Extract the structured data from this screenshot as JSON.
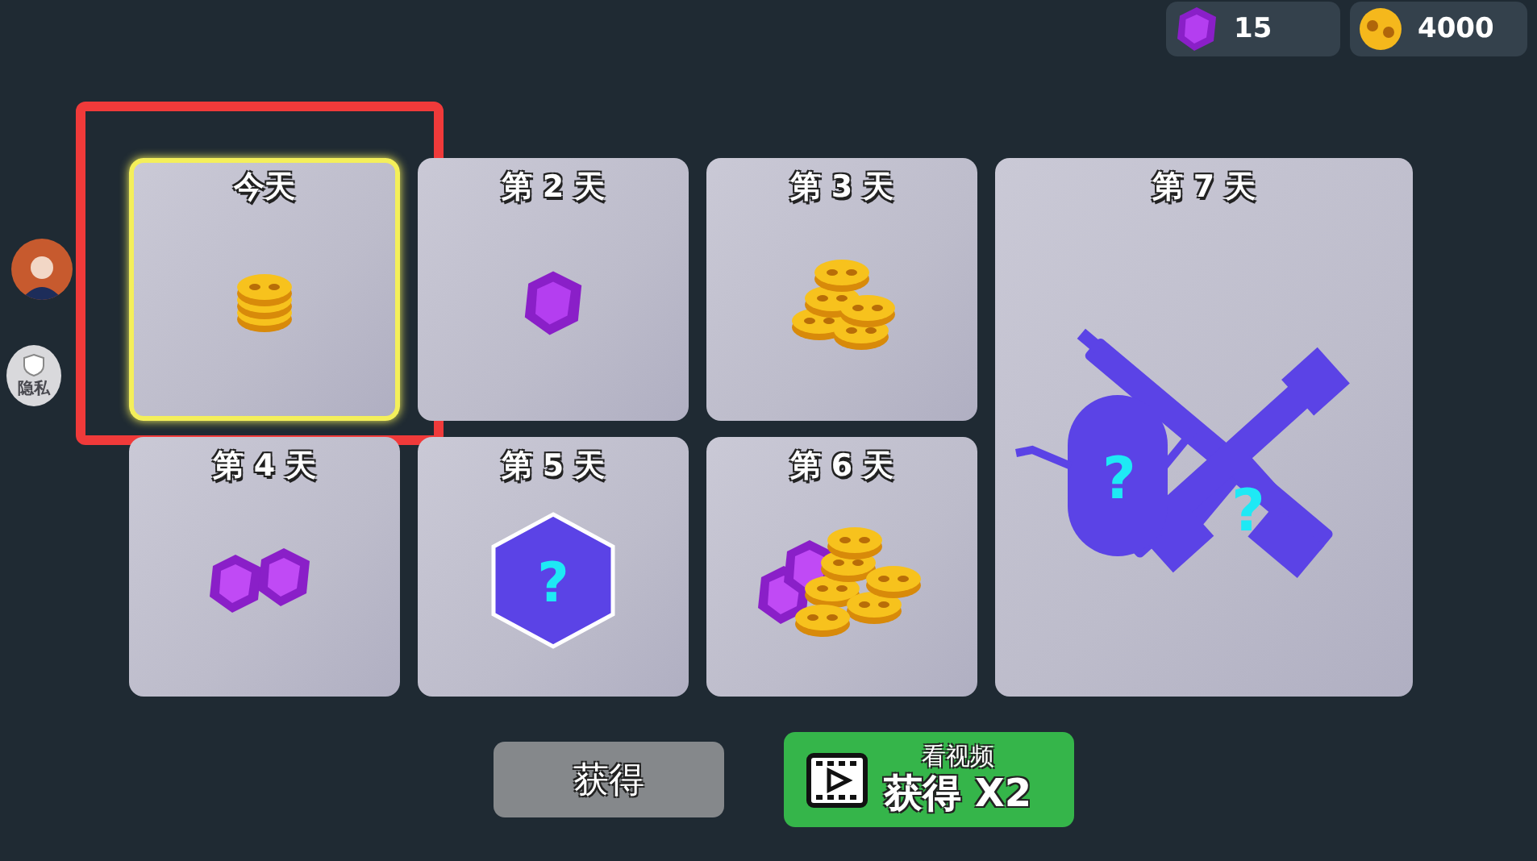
{
  "currencies": [
    {
      "kind": "gem",
      "amount": "15"
    },
    {
      "kind": "coin",
      "amount": "4000"
    }
  ],
  "side": {
    "privacy_label": "隐私"
  },
  "days": [
    {
      "label": "今天",
      "kind": "coin-stack",
      "selected": true,
      "highlighted": true
    },
    {
      "label": "第 2 天",
      "kind": "gem",
      "selected": false,
      "highlighted": false
    },
    {
      "label": "第 3 天",
      "kind": "coin-pile",
      "selected": false,
      "highlighted": false
    },
    {
      "label": "第 7 天",
      "kind": "mystery-weapons",
      "selected": false,
      "highlighted": false,
      "marks": [
        "?",
        "?"
      ]
    },
    {
      "label": "第 4 天",
      "kind": "gems",
      "selected": false,
      "highlighted": false
    },
    {
      "label": "第 5 天",
      "kind": "mystery",
      "selected": false,
      "highlighted": false,
      "marks": [
        "?"
      ]
    },
    {
      "label": "第 6 天",
      "kind": "gem-coin-pile",
      "selected": false,
      "highlighted": false
    }
  ],
  "buttons": {
    "claim": "获得",
    "video_top": "看视频",
    "video_main": "获得 X2"
  }
}
